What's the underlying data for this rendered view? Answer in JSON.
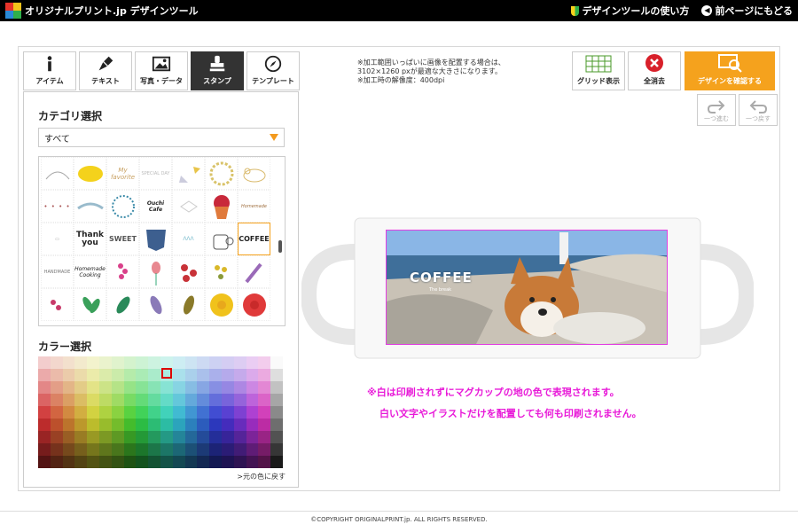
{
  "header": {
    "site_name": "オリジナルプリント.jp デザインツール",
    "howto_label": "デザインツールの使い方",
    "back_label": "前ページにもどる"
  },
  "tabs": [
    {
      "label": "アイテム",
      "icon": "info-icon"
    },
    {
      "label": "テキスト",
      "icon": "pen-icon"
    },
    {
      "label": "写真・データ",
      "icon": "image-icon"
    },
    {
      "label": "スタンプ",
      "icon": "stamp-icon",
      "active": true
    },
    {
      "label": "テンプレート",
      "icon": "compass-icon"
    }
  ],
  "panel": {
    "category_title": "カテゴリ選択",
    "category_value": "すべて",
    "color_title": "カラー選択",
    "reset_color_label": ">元の色に戻す"
  },
  "stamps": {
    "thank_you": "Thank you",
    "sweet": "SWEET",
    "coffee": "COFFEE",
    "homemade": "Homemade Cooking",
    "ouchi": "Ouchi Cafe",
    "my_favorite": "My favorite"
  },
  "notes": {
    "line1": "※加工範囲いっぱいに画像を配置する場合は、",
    "line2": "3102×1260 pxが最適な大きさになります。",
    "line3": "※加工時の解像度：400dpi"
  },
  "toolbar": {
    "grid_label": "グリッド表示",
    "clear_label": "全消去",
    "confirm_label": "デザインを確認する",
    "redo_label": "一つ進む",
    "undo_label": "一つ戻す"
  },
  "canvas": {
    "photo_text": "COFFEE",
    "photo_subtext": "The break"
  },
  "warning": {
    "line1": "※白は印刷されずにマグカップの地の色で表現されます。",
    "line2": "白い文字やイラストだけを配置しても何も印刷されません。"
  },
  "footer": {
    "copyright": "©COPYRIGHT ORIGINALPRINT.jp. ALL RIGHTS RESERVED."
  },
  "colors": {
    "accent_orange": "#f5a21d",
    "warning_pink": "#e81ad8",
    "active_tab": "#333333"
  }
}
